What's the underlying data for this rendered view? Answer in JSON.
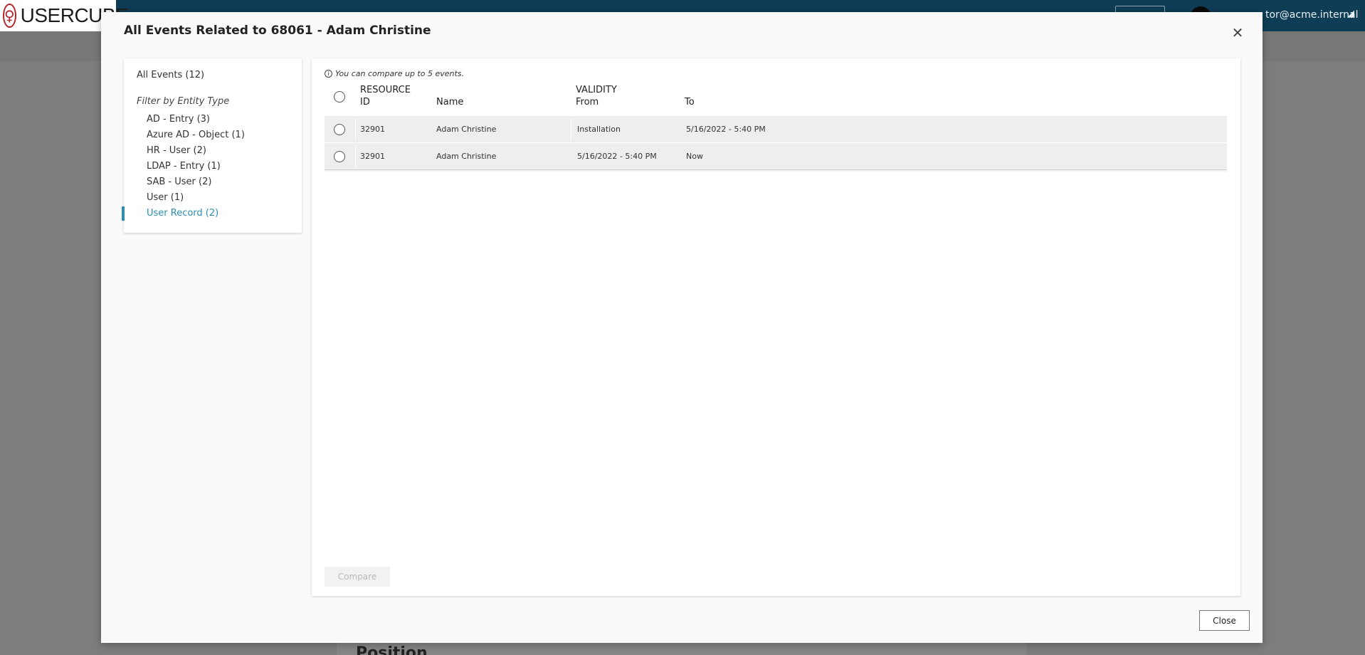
{
  "app": {
    "logo_text": "USERCUBE",
    "user_email": "tor@acme.internal",
    "page_heading": "Position"
  },
  "modal": {
    "title": "All Events Related to 68061 - Adam Christine",
    "close_glyph": "✕",
    "close_button_label": "Close"
  },
  "filters": {
    "all_events": "All Events (12)",
    "heading": "Filter by Entity Type",
    "items": [
      {
        "label": "AD - Entry (3)",
        "active": false
      },
      {
        "label": "Azure AD - Object (1)",
        "active": false
      },
      {
        "label": "HR - User (2)",
        "active": false
      },
      {
        "label": "LDAP - Entry (1)",
        "active": false
      },
      {
        "label": "SAB - User (2)",
        "active": false
      },
      {
        "label": "User (1)",
        "active": false
      },
      {
        "label": "User Record (2)",
        "active": true
      }
    ]
  },
  "events": {
    "info_text": "You can compare up to 5 events.",
    "headers": {
      "resource_line1": "RESOURCE",
      "resource_line2": "ID",
      "name": "Name",
      "validity": "VALIDITY",
      "from": "From",
      "to": "To"
    },
    "rows": [
      {
        "id": "32901",
        "name": "Adam Christine",
        "from": "Installation",
        "to": "5/16/2022  - 5:40 PM"
      },
      {
        "id": "32901",
        "name": "Adam Christine",
        "from": "5/16/2022  - 5:40 PM",
        "to": "Now"
      }
    ],
    "compare_label": "Compare"
  },
  "colors": {
    "accent": "#2a8fb5",
    "header_bar": "#0f3d55"
  }
}
